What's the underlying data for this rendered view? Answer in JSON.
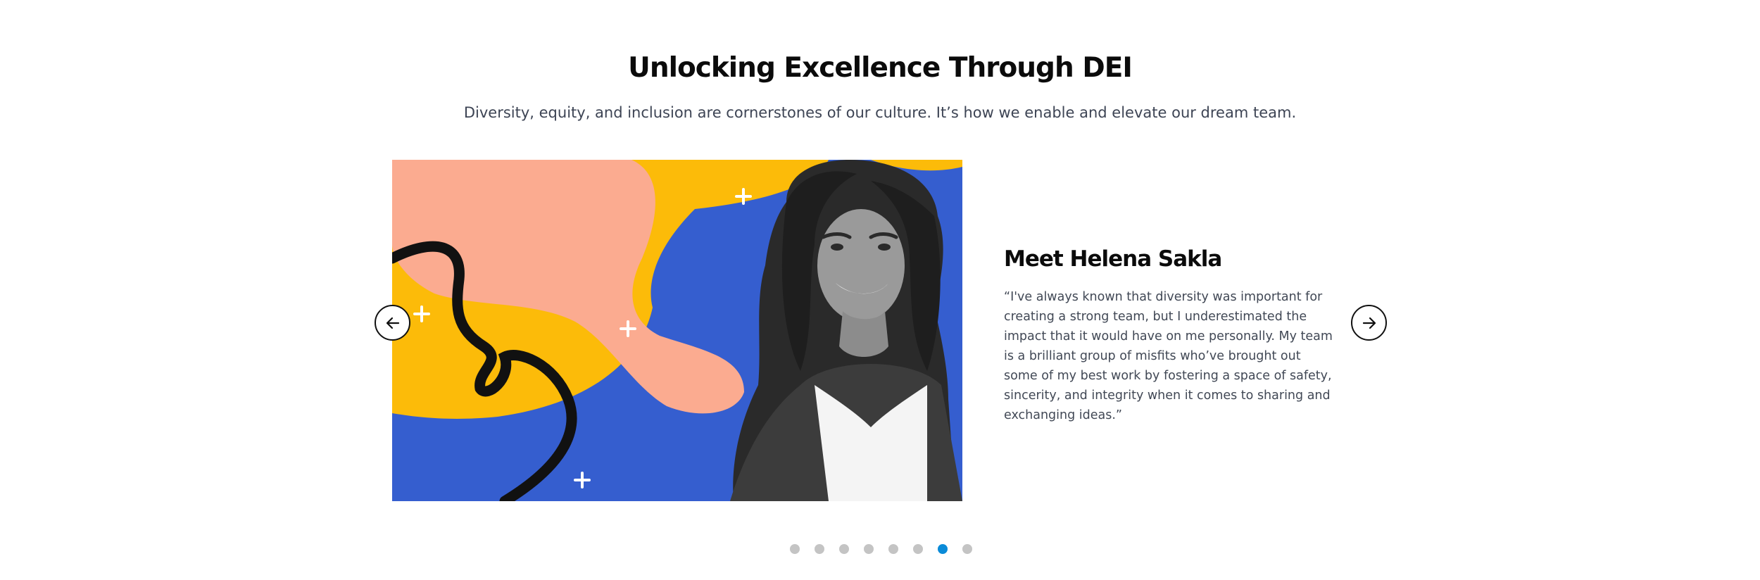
{
  "section": {
    "title": "Unlocking Excellence Through DEI",
    "subtitle": "Diversity, equity, and inclusion are cornerstones of our culture. It’s how we enable and elevate our dream team."
  },
  "slide": {
    "name": "Meet Helena Sakla",
    "quote": "“I've always known that diversity was important for creating a strong team, but I underestimated the impact that it would have on me personally. My team is a brilliant group of misfits who’ve brought out some of my best work by fostering a space of safety, sincerity, and integrity when it comes to sharing and exchanging ideas.”"
  },
  "carousel": {
    "total_slides": 8,
    "active_index": 7,
    "prev_icon": "arrow-left-icon",
    "next_icon": "arrow-right-icon"
  },
  "colors": {
    "active_dot": "#0a8bd8",
    "inactive_dot": "#c4c4c4",
    "art_blue": "#355ecf",
    "art_yellow": "#fcbb09",
    "art_peach": "#fbab90"
  }
}
